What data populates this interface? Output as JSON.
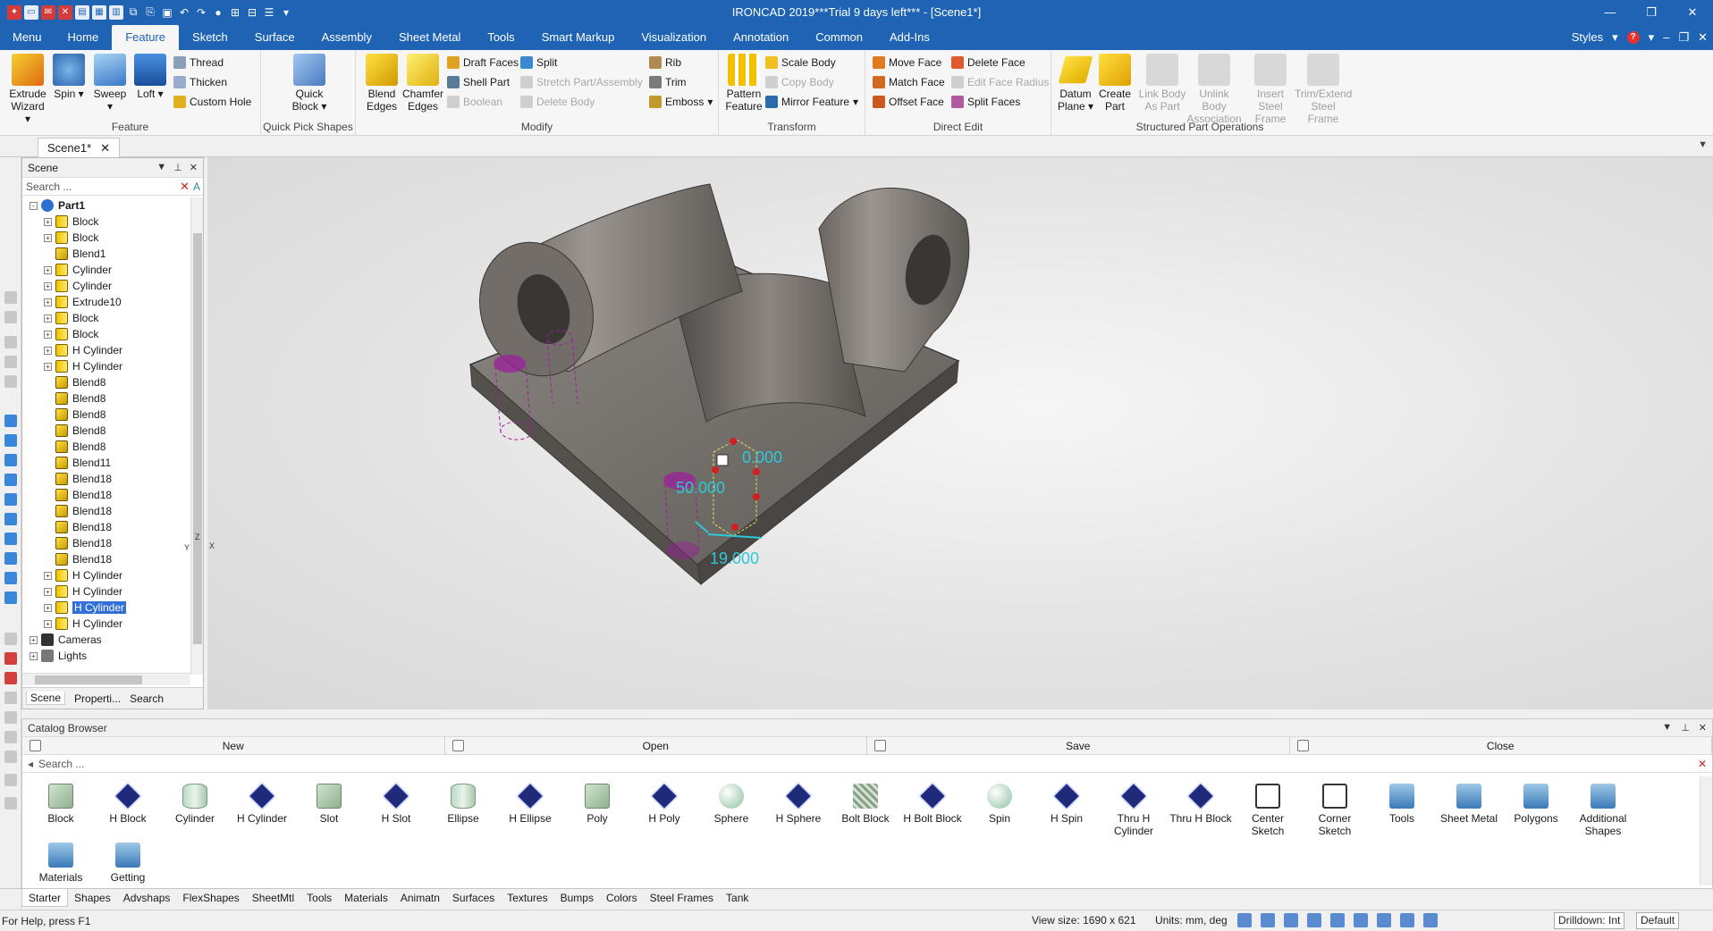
{
  "window": {
    "title": "IRONCAD 2019***Trial 9 days left*** - [Scene1*]"
  },
  "tabs": [
    {
      "label": "Menu"
    },
    {
      "label": "Home"
    },
    {
      "label": "Feature"
    },
    {
      "label": "Sketch"
    },
    {
      "label": "Surface"
    },
    {
      "label": "Assembly"
    },
    {
      "label": "Sheet Metal"
    },
    {
      "label": "Tools"
    },
    {
      "label": "Smart Markup"
    },
    {
      "label": "Visualization"
    },
    {
      "label": "Annotation"
    },
    {
      "label": "Common"
    },
    {
      "label": "Add-Ins"
    }
  ],
  "tabs_right": {
    "styles": "Styles"
  },
  "ribbon": {
    "feature": {
      "label": "Feature",
      "extrude": "Extrude Wizard",
      "spin": "Spin",
      "sweep": "Sweep",
      "loft": "Loft",
      "thread": "Thread",
      "thicken": "Thicken",
      "custom_hole": "Custom Hole"
    },
    "quick": {
      "label": "Quick Pick Shapes",
      "quick_block": "Quick Block"
    },
    "modify": {
      "label": "Modify",
      "blend": "Blend Edges",
      "chamfer": "Chamfer Edges",
      "draft": "Draft Faces",
      "shell": "Shell Part",
      "boolean": "Boolean",
      "split": "Split",
      "stretch": "Stretch Part/Assembly",
      "delete_body": "Delete Body",
      "rib": "Rib",
      "trim": "Trim",
      "emboss": "Emboss"
    },
    "transform": {
      "label": "Transform",
      "pattern": "Pattern Feature",
      "scale": "Scale Body",
      "copy": "Copy Body",
      "mirror": "Mirror Feature"
    },
    "direct": {
      "label": "Direct Edit",
      "move": "Move Face",
      "match": "Match Face",
      "offset": "Offset Face",
      "delete": "Delete Face",
      "radius": "Edit Face Radius",
      "split_faces": "Split Faces"
    },
    "structured": {
      "label": "Structured Part Operations",
      "datum": "Datum Plane",
      "create": "Create Part",
      "link": "Link Body As Part",
      "unlink": "Unlink Body Association",
      "insert": "Insert Steel Frame",
      "trimext": "Trim/Extend Steel Frame"
    }
  },
  "doc_tab": "Scene1*",
  "scene": {
    "title": "Scene",
    "search_placeholder": "Search ...",
    "tree": [
      {
        "label": "Part1",
        "level": 0,
        "icon": "part-icon",
        "expand": "-"
      },
      {
        "label": "Block",
        "level": 1,
        "icon": "cyl-icon",
        "expand": "+"
      },
      {
        "label": "Block",
        "level": 1,
        "icon": "cyl-icon",
        "expand": "+"
      },
      {
        "label": "Blend1",
        "level": 1,
        "icon": "blend-icon",
        "expand": ""
      },
      {
        "label": "Cylinder",
        "level": 1,
        "icon": "cyl-icon",
        "expand": "+"
      },
      {
        "label": "Cylinder",
        "level": 1,
        "icon": "cyl-icon",
        "expand": "+"
      },
      {
        "label": "Extrude10",
        "level": 1,
        "icon": "cyl-icon",
        "expand": "+"
      },
      {
        "label": "Block",
        "level": 1,
        "icon": "cyl-icon",
        "expand": "+"
      },
      {
        "label": "Block",
        "level": 1,
        "icon": "cyl-icon",
        "expand": "+"
      },
      {
        "label": "H Cylinder",
        "level": 1,
        "icon": "cyl-icon",
        "expand": "+"
      },
      {
        "label": "H Cylinder",
        "level": 1,
        "icon": "cyl-icon",
        "expand": "+"
      },
      {
        "label": "Blend8",
        "level": 1,
        "icon": "blend-icon",
        "expand": ""
      },
      {
        "label": "Blend8",
        "level": 1,
        "icon": "blend-icon",
        "expand": ""
      },
      {
        "label": "Blend8",
        "level": 1,
        "icon": "blend-icon",
        "expand": ""
      },
      {
        "label": "Blend8",
        "level": 1,
        "icon": "blend-icon",
        "expand": ""
      },
      {
        "label": "Blend8",
        "level": 1,
        "icon": "blend-icon",
        "expand": ""
      },
      {
        "label": "Blend11",
        "level": 1,
        "icon": "blend-icon",
        "expand": ""
      },
      {
        "label": "Blend18",
        "level": 1,
        "icon": "blend-icon",
        "expand": ""
      },
      {
        "label": "Blend18",
        "level": 1,
        "icon": "blend-icon",
        "expand": ""
      },
      {
        "label": "Blend18",
        "level": 1,
        "icon": "blend-icon",
        "expand": ""
      },
      {
        "label": "Blend18",
        "level": 1,
        "icon": "blend-icon",
        "expand": ""
      },
      {
        "label": "Blend18",
        "level": 1,
        "icon": "blend-icon",
        "expand": ""
      },
      {
        "label": "Blend18",
        "level": 1,
        "icon": "blend-icon",
        "expand": ""
      },
      {
        "label": "H Cylinder",
        "level": 1,
        "icon": "cyl-icon",
        "expand": "+"
      },
      {
        "label": "H Cylinder",
        "level": 1,
        "icon": "cyl-icon",
        "expand": "+"
      },
      {
        "label": "H Cylinder",
        "level": 1,
        "icon": "cyl-icon",
        "expand": "+",
        "selected": true
      },
      {
        "label": "H Cylinder",
        "level": 1,
        "icon": "cyl-icon",
        "expand": "+"
      },
      {
        "label": "Cameras",
        "level": 0,
        "icon": "camera-icon",
        "expand": "+"
      },
      {
        "label": "Lights",
        "level": 0,
        "icon": "light-icon",
        "expand": "+"
      }
    ],
    "bottom_tabs": [
      "Scene",
      "Properti...",
      "Search"
    ]
  },
  "viewport": {
    "dim_top": "0.000",
    "dim_left": "50.000",
    "dim_bottom": "19.000",
    "axis_z": "Z",
    "axis_x": "X",
    "axis_y": "Y"
  },
  "catalog": {
    "title": "Catalog Browser",
    "new": "New",
    "open": "Open",
    "save": "Save",
    "close": "Close",
    "search_placeholder": "Search ...",
    "items": [
      {
        "label": "Block",
        "shape": "block"
      },
      {
        "label": "H Block",
        "shape": "hole"
      },
      {
        "label": "Cylinder",
        "shape": "cyl"
      },
      {
        "label": "H Cylinder",
        "shape": "hole"
      },
      {
        "label": "Slot",
        "shape": "block"
      },
      {
        "label": "H Slot",
        "shape": "hole"
      },
      {
        "label": "Ellipse",
        "shape": "cyl"
      },
      {
        "label": "H Ellipse",
        "shape": "hole"
      },
      {
        "label": "Poly",
        "shape": "block"
      },
      {
        "label": "H Poly",
        "shape": "hole"
      },
      {
        "label": "Sphere",
        "shape": "sphere"
      },
      {
        "label": "H Sphere",
        "shape": "hole"
      },
      {
        "label": "Bolt Block",
        "shape": "bolt"
      },
      {
        "label": "H Bolt Block",
        "shape": "hole"
      },
      {
        "label": "Spin",
        "shape": "sphere"
      },
      {
        "label": "H Spin",
        "shape": "hole"
      },
      {
        "label": "Thru H Cylinder",
        "shape": "hole"
      },
      {
        "label": "Thru H Block",
        "shape": "hole"
      },
      {
        "label": "Center Sketch",
        "shape": "sketch"
      },
      {
        "label": "Corner Sketch",
        "shape": "sketch"
      },
      {
        "label": "Tools",
        "shape": "folder"
      },
      {
        "label": "Sheet Metal",
        "shape": "folder"
      },
      {
        "label": "Polygons",
        "shape": "folder"
      },
      {
        "label": "Additional Shapes",
        "shape": "folder"
      },
      {
        "label": "Materials",
        "shape": "folder"
      },
      {
        "label": "Getting",
        "shape": "folder"
      }
    ],
    "tabs": [
      "Starter",
      "Shapes",
      "Advshaps",
      "FlexShapes",
      "SheetMtl",
      "Tools",
      "Materials",
      "Animatn",
      "Surfaces",
      "Textures",
      "Bumps",
      "Colors",
      "Steel Frames",
      "Tank"
    ]
  },
  "status": {
    "help": "For Help, press F1",
    "view_size": "View size: 1690 x 621",
    "units": "Units: mm, deg",
    "drilldown": "Drilldown: Int",
    "style": "Default"
  },
  "colors": {
    "accent": "#1f63b4",
    "part": "#6e6a66",
    "selection": "#3070d8",
    "hole": "#9b1f9b",
    "dimension": "#2fc8d8"
  }
}
